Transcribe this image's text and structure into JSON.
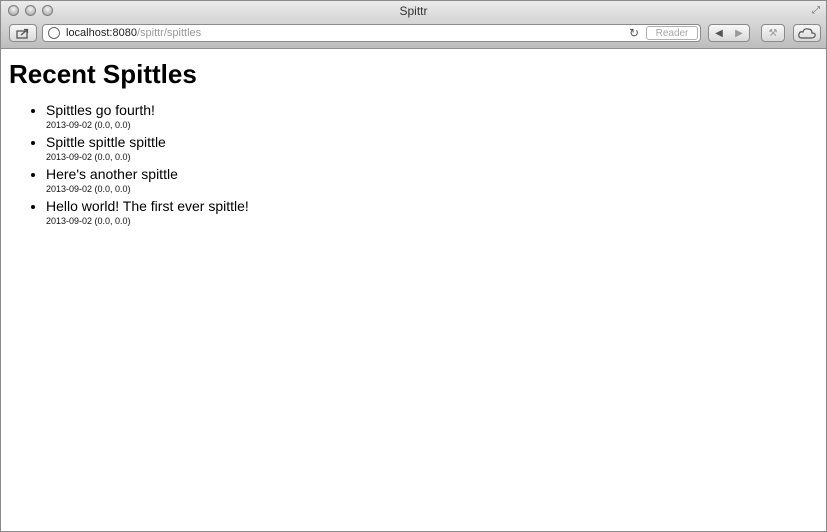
{
  "window": {
    "title": "Spittr"
  },
  "address_bar": {
    "host": "localhost:8080",
    "path": "/spittr/spittles"
  },
  "toolbar": {
    "reader_label": "Reader"
  },
  "page": {
    "heading": "Recent Spittles",
    "spittles": [
      {
        "message": "Spittles go fourth!",
        "meta": "2013-09-02 (0.0, 0.0)"
      },
      {
        "message": "Spittle spittle spittle",
        "meta": "2013-09-02 (0.0, 0.0)"
      },
      {
        "message": "Here's another spittle",
        "meta": "2013-09-02 (0.0, 0.0)"
      },
      {
        "message": "Hello world! The first ever spittle!",
        "meta": "2013-09-02 (0.0, 0.0)"
      }
    ]
  }
}
